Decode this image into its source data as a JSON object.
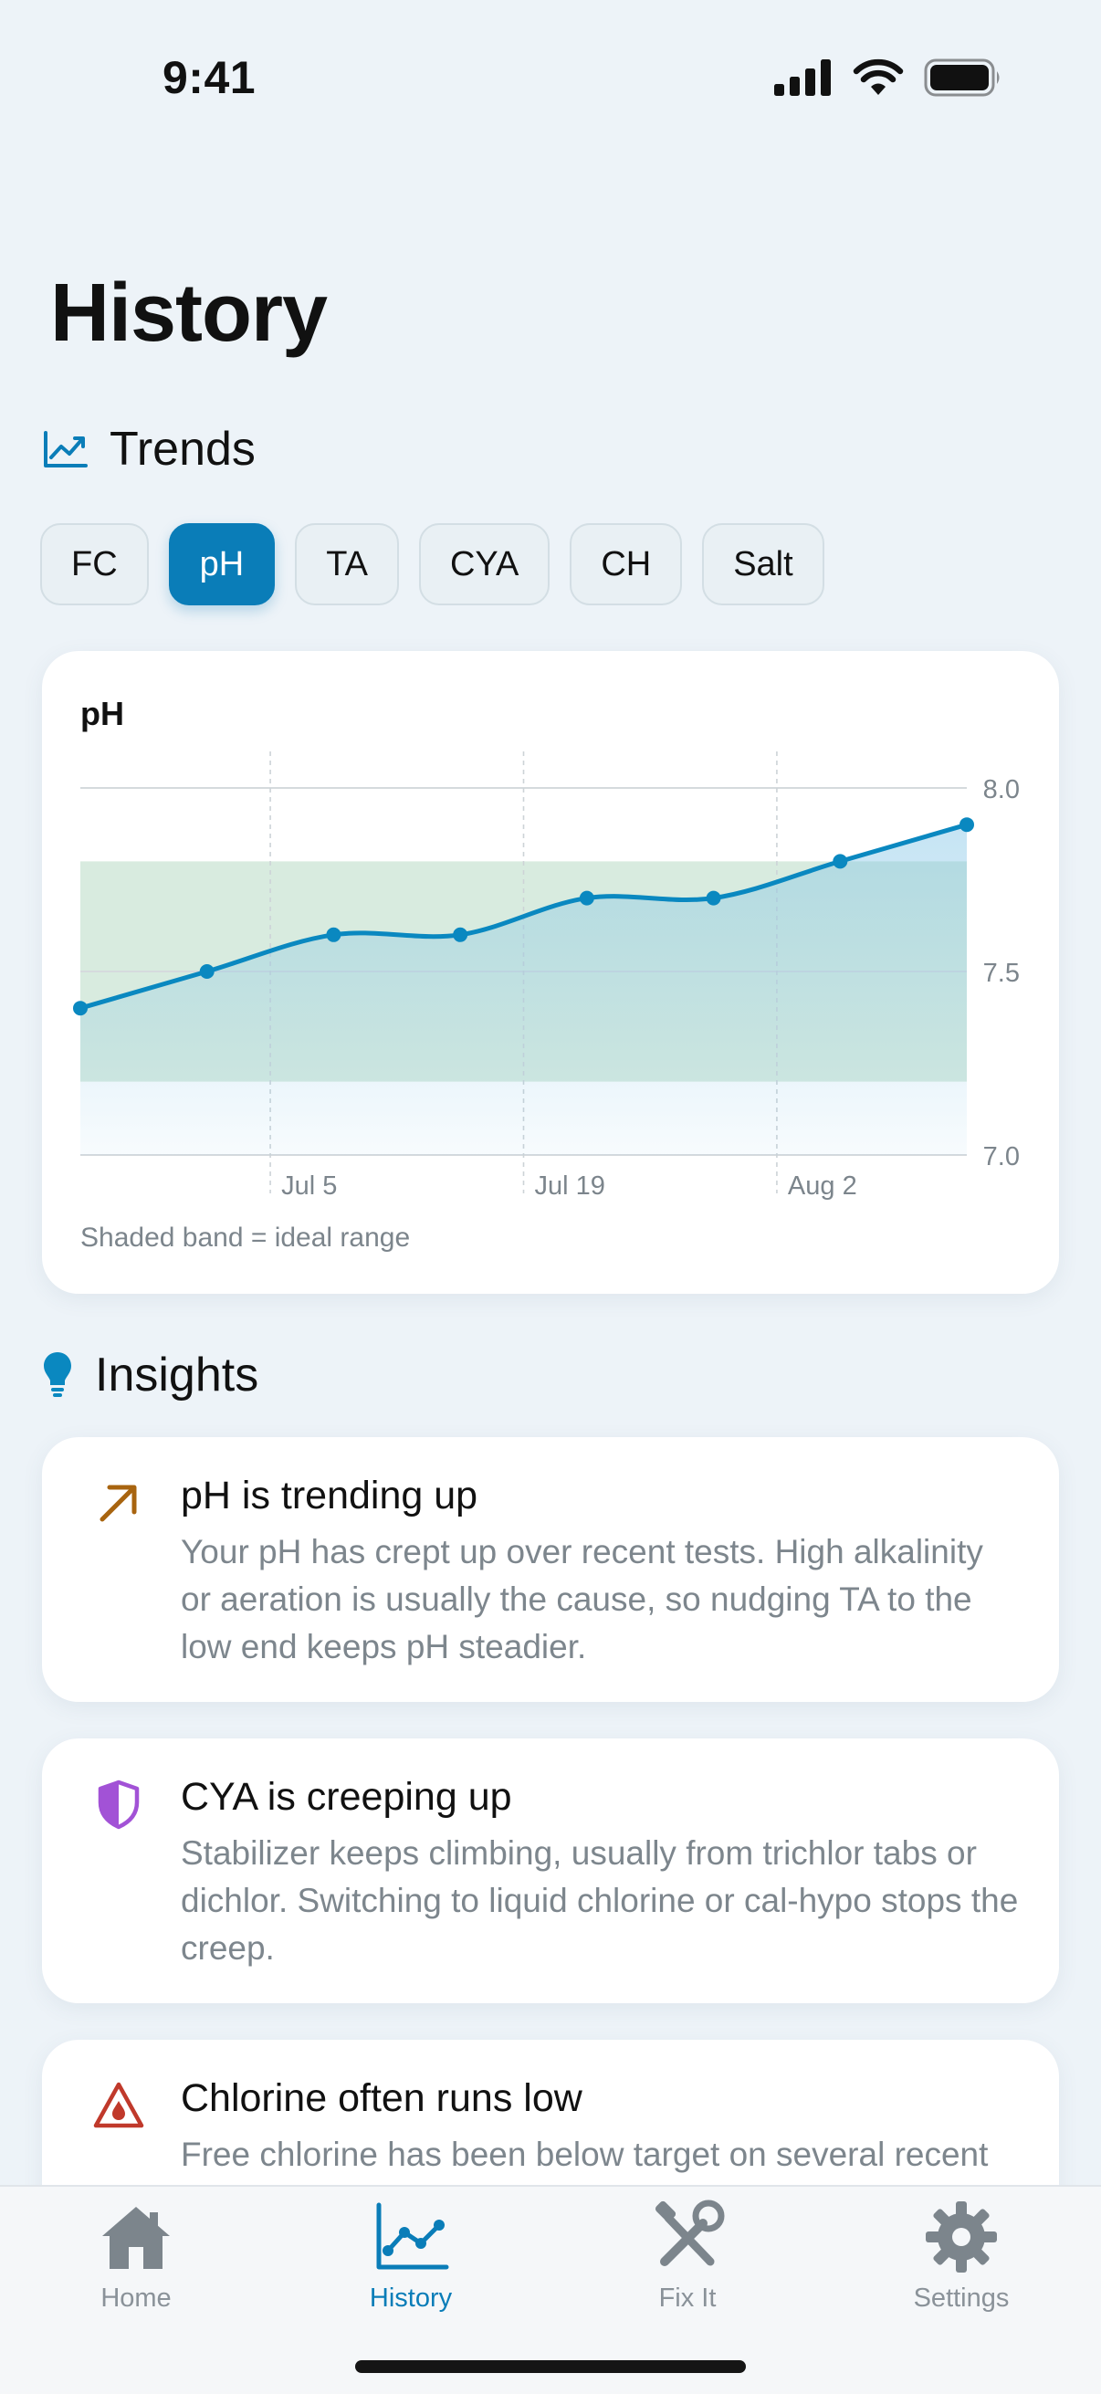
{
  "status_bar": {
    "time": "9:41"
  },
  "page": {
    "title": "History"
  },
  "trends": {
    "heading": "Trends",
    "chips": [
      "FC",
      "pH",
      "TA",
      "CYA",
      "CH",
      "Salt"
    ],
    "active_chip": "pH"
  },
  "chart": {
    "title": "pH",
    "caption": "Shaded band = ideal range"
  },
  "chart_data": {
    "type": "line",
    "title": "pH",
    "series": [
      {
        "x": [
          "Jun 23",
          "Jun 30",
          "Jul 7",
          "Jul 14",
          "Jul 21",
          "Jul 28",
          "Aug 4",
          "Aug 11"
        ],
        "values": [
          7.4,
          7.5,
          7.6,
          7.6,
          7.7,
          7.7,
          7.8,
          7.9
        ]
      }
    ],
    "x_ticks": [
      "Jul 5",
      "Jul 19",
      "Aug 2"
    ],
    "y_ticks": [
      7.0,
      7.5,
      8.0
    ],
    "ylim": [
      7.0,
      8.0
    ],
    "ideal_range": [
      7.2,
      7.8
    ],
    "grid": true,
    "colors": {
      "line": "#0a88c0",
      "band": "#a9d3b8"
    }
  },
  "insights": {
    "heading": "Insights",
    "items": [
      {
        "icon": "arrow-up-right-icon",
        "title": "pH is trending up",
        "body": "Your pH has crept up over recent tests. High alkalinity or aeration is usually the cause, so nudging TA to the low end keeps pH steadier.",
        "color": "#a8640f"
      },
      {
        "icon": "shield-icon",
        "title": "CYA is creeping up",
        "body": "Stabilizer keeps climbing, usually from trichlor tabs or dichlor. Switching to liquid chlorine or cal-hypo stops the creep.",
        "color": "#a252d6"
      },
      {
        "icon": "warning-drop-icon",
        "title": "Chlorine often runs low",
        "body": "Free chlorine has been below target on several recent tests.",
        "color": "#c0392b"
      }
    ]
  },
  "tab_bar": {
    "tabs": [
      {
        "label": "Home",
        "icon": "house-icon"
      },
      {
        "label": "History",
        "icon": "chart-icon"
      },
      {
        "label": "Fix It",
        "icon": "tools-icon"
      },
      {
        "label": "Settings",
        "icon": "gear-icon"
      }
    ],
    "active": "History"
  }
}
